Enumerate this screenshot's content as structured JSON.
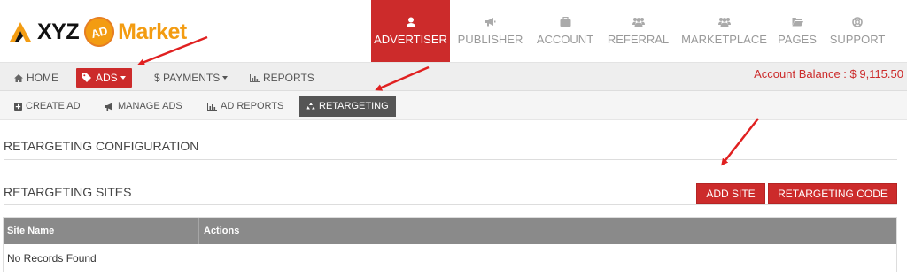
{
  "logo": {
    "part1": "XYZ",
    "badge": "AD",
    "part2": "Market"
  },
  "top_nav": [
    {
      "label": "ADVERTISER",
      "icon": "user-icon",
      "active": true
    },
    {
      "label": "PUBLISHER",
      "icon": "bullhorn-icon"
    },
    {
      "label": "ACCOUNT",
      "icon": "briefcase-icon"
    },
    {
      "label": "REFERRAL",
      "icon": "users-icon"
    },
    {
      "label": "MARKETPLACE",
      "icon": "users-icon"
    },
    {
      "label": "PAGES",
      "icon": "folder-open-icon"
    },
    {
      "label": "SUPPORT",
      "icon": "life-ring-icon"
    }
  ],
  "sub_nav": {
    "home": "HOME",
    "ads": "ADS",
    "payments": "$ PAYMENTS",
    "reports": "REPORTS"
  },
  "account_balance": "Account Balance : $ 9,115.50",
  "ads_nav": {
    "create": "CREATE AD",
    "manage": "MANAGE ADS",
    "reports": "AD REPORTS",
    "retargeting": "RETARGETING"
  },
  "sections": {
    "config_title": "RETARGETING CONFIGURATION",
    "sites_title": "RETARGETING SITES"
  },
  "buttons": {
    "add_site": "ADD SITE",
    "retargeting_code": "RETARGETING CODE"
  },
  "table": {
    "columns": [
      "Site Name",
      "Actions"
    ],
    "empty_message": "No Records Found"
  },
  "colors": {
    "accent": "#cc2b2b",
    "brand_orange": "#f39c12",
    "table_header": "#8a8a8a",
    "active_subtab": "#555555"
  }
}
